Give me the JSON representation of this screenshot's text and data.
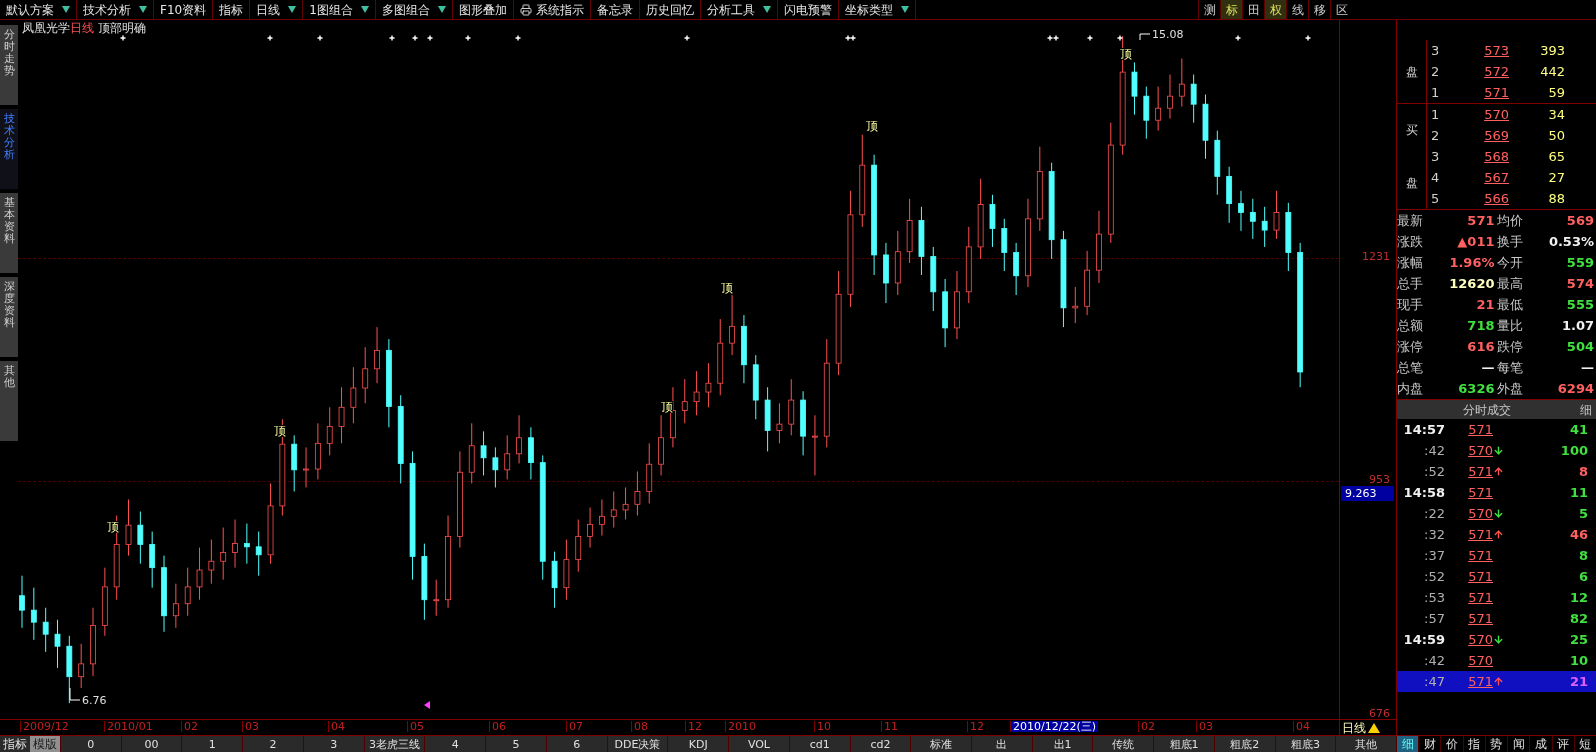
{
  "toolbar": [
    {
      "label": "默认方案",
      "dropdown": true,
      "icon": false
    },
    {
      "label": "技术分析",
      "dropdown": true,
      "icon": false
    },
    {
      "label": "F10资料",
      "dropdown": false,
      "icon": false
    },
    {
      "label": "指标",
      "dropdown": false,
      "icon": false
    },
    {
      "label": "日线",
      "dropdown": true,
      "icon": false
    },
    {
      "label": "1图组合",
      "dropdown": true,
      "icon": false
    },
    {
      "label": "多图组合",
      "dropdown": true,
      "icon": false
    },
    {
      "label": "图形叠加",
      "dropdown": false,
      "icon": false
    },
    {
      "label": "系统指示",
      "dropdown": false,
      "icon": true
    },
    {
      "label": "备忘录",
      "dropdown": false,
      "icon": false
    },
    {
      "label": "历史回忆",
      "dropdown": false,
      "icon": false
    },
    {
      "label": "分析工具",
      "dropdown": true,
      "icon": false
    },
    {
      "label": "闪电预警",
      "dropdown": false,
      "icon": false
    },
    {
      "label": "坐标类型",
      "dropdown": true,
      "icon": false
    }
  ],
  "tool_buttons": [
    {
      "label": "测",
      "selected": false
    },
    {
      "label": "标",
      "selected": true
    },
    {
      "label": "田",
      "selected": false
    },
    {
      "label": "权",
      "selected": true
    },
    {
      "label": "线",
      "selected": false
    },
    {
      "label": "移",
      "selected": false
    },
    {
      "label": "区",
      "selected": false
    }
  ],
  "side_tabs": [
    {
      "label": "分时走势",
      "selected": false
    },
    {
      "label": "技术分析",
      "selected": true
    },
    {
      "label": "基本资料",
      "selected": false
    },
    {
      "label": "深度资料",
      "selected": false
    },
    {
      "label": "其他",
      "selected": false
    }
  ],
  "chart": {
    "stock": "凤凰光学",
    "period": "日线",
    "signal": "顶部明确",
    "markers": [
      "顶",
      "顶",
      "顶",
      "顶",
      "顶",
      "顶"
    ],
    "high_label": "15.08",
    "low_label": "6.76",
    "y_labels": [
      "1231",
      "953",
      "676"
    ],
    "cursor_value": "9.263",
    "x_labels": [
      {
        "label": "2009/12",
        "selected": false
      },
      {
        "label": "2010/01",
        "selected": false
      },
      {
        "label": "02",
        "selected": false
      },
      {
        "label": "03",
        "selected": false
      },
      {
        "label": "04",
        "selected": false
      },
      {
        "label": "05",
        "selected": false
      },
      {
        "label": "06",
        "selected": false
      },
      {
        "label": "07",
        "selected": false
      },
      {
        "label": "08",
        "selected": false
      },
      {
        "label": "12",
        "selected": false
      },
      {
        "label": "2010",
        "selected": false
      },
      {
        "label": "10",
        "selected": false
      },
      {
        "label": "11",
        "selected": false
      },
      {
        "label": "12",
        "selected": false
      },
      {
        "label": "2010/12/22(三)",
        "selected": true
      },
      {
        "label": "02",
        "selected": false
      },
      {
        "label": "03",
        "selected": false
      },
      {
        "label": "04",
        "selected": false
      }
    ],
    "period_button": "日线",
    "chart_data": {
      "type": "candlestick",
      "ohlc": [
        [
          8.1,
          8.35,
          7.7,
          7.92
        ],
        [
          7.92,
          8.2,
          7.55,
          7.77
        ],
        [
          7.77,
          7.95,
          7.4,
          7.62
        ],
        [
          7.62,
          7.8,
          7.2,
          7.47
        ],
        [
          7.47,
          7.6,
          6.76,
          7.09
        ],
        [
          7.09,
          7.5,
          6.95,
          7.25
        ],
        [
          7.25,
          7.95,
          7.1,
          7.73
        ],
        [
          7.73,
          8.45,
          7.6,
          8.21
        ],
        [
          8.21,
          9.1,
          8.05,
          8.74
        ],
        [
          8.74,
          9.3,
          8.6,
          8.98
        ],
        [
          8.98,
          9.15,
          8.5,
          8.74
        ],
        [
          8.74,
          8.9,
          8.2,
          8.45
        ],
        [
          8.45,
          8.6,
          7.65,
          7.85
        ],
        [
          7.85,
          8.25,
          7.7,
          8.0
        ],
        [
          8.0,
          8.45,
          7.85,
          8.21
        ],
        [
          8.21,
          8.7,
          8.05,
          8.42
        ],
        [
          8.42,
          8.8,
          8.25,
          8.53
        ],
        [
          8.53,
          8.95,
          8.3,
          8.64
        ],
        [
          8.64,
          9.05,
          8.45,
          8.75
        ],
        [
          8.75,
          9.0,
          8.5,
          8.71
        ],
        [
          8.71,
          8.9,
          8.35,
          8.61
        ],
        [
          8.61,
          9.5,
          8.5,
          9.22
        ],
        [
          9.22,
          10.3,
          9.1,
          9.99
        ],
        [
          9.99,
          10.1,
          9.4,
          9.67
        ],
        [
          9.67,
          9.95,
          9.45,
          9.68
        ],
        [
          9.68,
          10.25,
          9.55,
          10.0
        ],
        [
          10.0,
          10.45,
          9.85,
          10.21
        ],
        [
          10.21,
          10.7,
          10.0,
          10.45
        ],
        [
          10.45,
          10.95,
          10.25,
          10.69
        ],
        [
          10.69,
          11.2,
          10.5,
          10.93
        ],
        [
          10.93,
          11.45,
          10.75,
          11.16
        ],
        [
          11.16,
          11.3,
          10.2,
          10.46
        ],
        [
          10.46,
          10.6,
          9.5,
          9.75
        ],
        [
          9.75,
          9.9,
          8.3,
          8.59
        ],
        [
          8.59,
          8.75,
          7.8,
          8.05
        ],
        [
          8.05,
          8.3,
          7.85,
          8.05
        ],
        [
          8.05,
          9.1,
          7.95,
          8.84
        ],
        [
          8.84,
          9.9,
          8.7,
          9.64
        ],
        [
          9.64,
          10.25,
          9.5,
          9.97
        ],
        [
          9.97,
          10.15,
          9.6,
          9.82
        ],
        [
          9.82,
          9.95,
          9.45,
          9.67
        ],
        [
          9.67,
          10.1,
          9.55,
          9.87
        ],
        [
          9.87,
          10.35,
          9.75,
          10.07
        ],
        [
          10.07,
          10.2,
          9.55,
          9.76
        ],
        [
          9.76,
          9.85,
          8.3,
          8.53
        ],
        [
          8.53,
          8.65,
          7.95,
          8.2
        ],
        [
          8.2,
          8.8,
          8.05,
          8.55
        ],
        [
          8.55,
          9.05,
          8.4,
          8.84
        ],
        [
          8.84,
          9.2,
          8.7,
          8.99
        ],
        [
          8.99,
          9.3,
          8.85,
          9.09
        ],
        [
          9.09,
          9.4,
          8.95,
          9.17
        ],
        [
          9.17,
          9.45,
          9.05,
          9.24
        ],
        [
          9.24,
          9.65,
          9.1,
          9.4
        ],
        [
          9.4,
          10.0,
          9.25,
          9.74
        ],
        [
          9.74,
          10.35,
          9.6,
          10.07
        ],
        [
          10.07,
          10.7,
          9.95,
          10.41
        ],
        [
          10.41,
          10.8,
          10.25,
          10.52
        ],
        [
          10.52,
          10.9,
          10.35,
          10.64
        ],
        [
          10.64,
          11.0,
          10.45,
          10.75
        ],
        [
          10.75,
          11.55,
          10.6,
          11.25
        ],
        [
          11.25,
          11.85,
          11.1,
          11.46
        ],
        [
          11.46,
          11.6,
          10.75,
          10.98
        ],
        [
          10.98,
          11.1,
          10.3,
          10.54
        ],
        [
          10.54,
          10.7,
          9.9,
          10.16
        ],
        [
          10.16,
          10.5,
          10.0,
          10.24
        ],
        [
          10.24,
          10.8,
          10.1,
          10.54
        ],
        [
          10.54,
          10.65,
          9.85,
          10.09
        ],
        [
          10.09,
          10.35,
          9.6,
          10.09
        ],
        [
          10.09,
          11.3,
          9.95,
          11.0
        ],
        [
          11.0,
          12.15,
          10.85,
          11.86
        ],
        [
          11.86,
          13.15,
          11.7,
          12.85
        ],
        [
          12.85,
          13.85,
          12.7,
          13.47
        ],
        [
          13.47,
          13.6,
          12.1,
          12.35
        ],
        [
          12.35,
          12.5,
          11.75,
          12.0
        ],
        [
          12.0,
          12.65,
          11.85,
          12.39
        ],
        [
          12.39,
          13.05,
          12.25,
          12.78
        ],
        [
          12.78,
          12.95,
          12.1,
          12.33
        ],
        [
          12.33,
          12.45,
          11.65,
          11.89
        ],
        [
          11.89,
          12.05,
          11.2,
          11.44
        ],
        [
          11.44,
          12.15,
          11.3,
          11.89
        ],
        [
          11.89,
          12.7,
          11.75,
          12.45
        ],
        [
          12.45,
          13.3,
          12.3,
          12.98
        ],
        [
          12.98,
          13.1,
          12.45,
          12.68
        ],
        [
          12.68,
          12.8,
          12.15,
          12.38
        ],
        [
          12.38,
          12.5,
          11.85,
          12.09
        ],
        [
          12.09,
          13.05,
          11.95,
          12.8
        ],
        [
          12.8,
          13.7,
          12.65,
          13.39
        ],
        [
          13.39,
          13.5,
          12.3,
          12.54
        ],
        [
          12.54,
          12.65,
          11.45,
          11.69
        ],
        [
          11.69,
          11.95,
          11.5,
          11.71
        ],
        [
          11.71,
          12.4,
          11.6,
          12.16
        ],
        [
          12.16,
          12.9,
          12.0,
          12.61
        ],
        [
          12.61,
          14.0,
          12.5,
          13.72
        ],
        [
          13.72,
          15.08,
          13.6,
          14.63
        ],
        [
          14.63,
          14.75,
          14.1,
          14.33
        ],
        [
          14.33,
          14.45,
          13.8,
          14.03
        ],
        [
          14.03,
          14.45,
          13.9,
          14.18
        ],
        [
          14.18,
          14.6,
          14.05,
          14.33
        ],
        [
          14.33,
          14.8,
          14.2,
          14.48
        ],
        [
          14.48,
          14.6,
          14.0,
          14.23
        ],
        [
          14.23,
          14.35,
          13.55,
          13.78
        ],
        [
          13.78,
          13.9,
          13.1,
          13.33
        ],
        [
          13.33,
          13.45,
          12.75,
          12.99
        ],
        [
          12.99,
          13.15,
          12.65,
          12.88
        ],
        [
          12.88,
          13.05,
          12.55,
          12.77
        ],
        [
          12.77,
          12.95,
          12.45,
          12.66
        ],
        [
          12.66,
          13.15,
          12.55,
          12.88
        ],
        [
          12.88,
          13.0,
          12.15,
          12.38
        ],
        [
          12.38,
          12.5,
          10.7,
          10.89
        ]
      ]
    }
  },
  "order_book": {
    "sell_label": "盘",
    "buy_label": [
      "买",
      "盘"
    ],
    "sell": [
      {
        "level": "3",
        "price": "573",
        "volume": "393"
      },
      {
        "level": "2",
        "price": "572",
        "volume": "442"
      },
      {
        "level": "1",
        "price": "571",
        "volume": "59"
      }
    ],
    "buy": [
      {
        "level": "1",
        "price": "570",
        "volume": "34"
      },
      {
        "level": "2",
        "price": "569",
        "volume": "50"
      },
      {
        "level": "3",
        "price": "568",
        "volume": "65"
      },
      {
        "level": "4",
        "price": "567",
        "volume": "27"
      },
      {
        "level": "5",
        "price": "566",
        "volume": "88"
      }
    ]
  },
  "stats": [
    [
      {
        "label": "最新",
        "value": "571",
        "color": "#ff6060"
      },
      {
        "label": "均价",
        "value": "569",
        "color": "#ff6060"
      }
    ],
    [
      {
        "label": "涨跌",
        "value": "▲011",
        "color": "#ff6060"
      },
      {
        "label": "换手",
        "value": "0.53%",
        "color": "#f0f0f0"
      }
    ],
    [
      {
        "label": "涨幅",
        "value": "1.96%",
        "color": "#ff6060"
      },
      {
        "label": "今开",
        "value": "559",
        "color": "#40e040"
      }
    ],
    [
      {
        "label": "总手",
        "value": "12620",
        "color": "#ffffc0"
      },
      {
        "label": "最高",
        "value": "574",
        "color": "#ff6060"
      }
    ],
    [
      {
        "label": "现手",
        "value": "21",
        "color": "#ff6060"
      },
      {
        "label": "最低",
        "value": "555",
        "color": "#40e040"
      }
    ],
    [
      {
        "label": "总额",
        "value": "718",
        "color": "#40e040"
      },
      {
        "label": "量比",
        "value": "1.07",
        "color": "#f0f0f0"
      }
    ],
    [
      {
        "label": "涨停",
        "value": "616",
        "color": "#ff6060"
      },
      {
        "label": "跌停",
        "value": "504",
        "color": "#40e040"
      }
    ],
    [
      {
        "label": "总笔",
        "value": "—",
        "color": "#f0f0f0"
      },
      {
        "label": "每笔",
        "value": "—",
        "color": "#f0f0f0"
      }
    ],
    [
      {
        "label": "内盘",
        "value": "6326",
        "color": "#40e040"
      },
      {
        "label": "外盘",
        "value": "6294",
        "color": "#ff6060"
      }
    ]
  ],
  "ticks_header": {
    "title": "分时成交",
    "detail": "细"
  },
  "ticks": [
    {
      "time": "14:57",
      "price": "571",
      "up": false,
      "down": false,
      "volume": "41",
      "color": "#40e040",
      "selected": false
    },
    {
      "time": ":42",
      "price": "570",
      "up": false,
      "down": true,
      "volume": "100",
      "color": "#40e040",
      "selected": false
    },
    {
      "time": ":52",
      "price": "571",
      "up": true,
      "down": false,
      "volume": "8",
      "color": "#ff6060",
      "selected": false
    },
    {
      "time": "14:58",
      "price": "571",
      "up": false,
      "down": false,
      "volume": "11",
      "color": "#40e040",
      "selected": false
    },
    {
      "time": ":22",
      "price": "570",
      "up": false,
      "down": true,
      "volume": "5",
      "color": "#40e040",
      "selected": false
    },
    {
      "time": ":32",
      "price": "571",
      "up": true,
      "down": false,
      "volume": "46",
      "color": "#ff6060",
      "selected": false
    },
    {
      "time": ":37",
      "price": "571",
      "up": false,
      "down": false,
      "volume": "8",
      "color": "#40e040",
      "selected": false
    },
    {
      "time": ":52",
      "price": "571",
      "up": false,
      "down": false,
      "volume": "6",
      "color": "#40e040",
      "selected": false
    },
    {
      "time": ":53",
      "price": "571",
      "up": false,
      "down": false,
      "volume": "12",
      "color": "#40e040",
      "selected": false
    },
    {
      "time": ":57",
      "price": "571",
      "up": false,
      "down": false,
      "volume": "82",
      "color": "#40e040",
      "selected": false
    },
    {
      "time": "14:59",
      "price": "570",
      "up": false,
      "down": true,
      "volume": "25",
      "color": "#40e040",
      "selected": false
    },
    {
      "time": ":42",
      "price": "570",
      "up": false,
      "down": false,
      "volume": "10",
      "color": "#40e040",
      "selected": false
    },
    {
      "time": ":47",
      "price": "571",
      "up": true,
      "down": false,
      "volume": "21",
      "color": "#e060ff",
      "selected": true
    }
  ],
  "panel_tabs": [
    {
      "label": "细",
      "selected": true
    },
    {
      "label": "财",
      "selected": false
    },
    {
      "label": "价",
      "selected": false
    },
    {
      "label": "指",
      "selected": false
    },
    {
      "label": "势",
      "selected": false
    },
    {
      "label": "闻",
      "selected": false
    },
    {
      "label": "成",
      "selected": false
    },
    {
      "label": "评",
      "selected": false
    },
    {
      "label": "短",
      "selected": false
    }
  ],
  "bottom_bar": {
    "title": "指标",
    "templates": {
      "label": "模版",
      "selected": true
    },
    "items": [
      "0",
      "00",
      "1",
      "2",
      "3",
      "3老虎三线",
      "4",
      "5",
      "6",
      "DDE决策",
      "KDJ",
      "VOL",
      "cd1",
      "cd2",
      "标准",
      "出",
      "出1",
      "传统",
      "粗底1",
      "粗底2",
      "粗底3",
      "其他"
    ]
  }
}
